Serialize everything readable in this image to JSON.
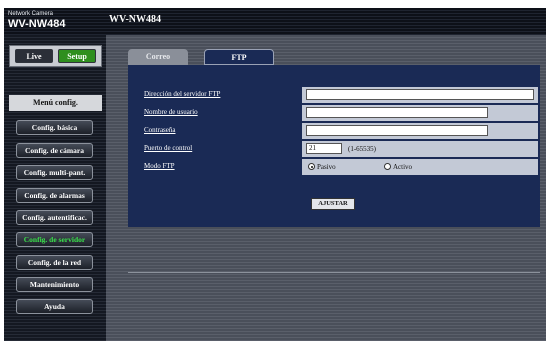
{
  "header": {
    "brand_small": "Network Camera",
    "brand_model": "WV-NW484",
    "model_title": "WV-NW484"
  },
  "mode": {
    "live_label": "Live",
    "setup_label": "Setup"
  },
  "sidebar": {
    "title": "Menú config.",
    "items": [
      {
        "label": "Config. básica"
      },
      {
        "label": "Config. de cámara"
      },
      {
        "label": "Config. multi-pant."
      },
      {
        "label": "Config. de alarmas"
      },
      {
        "label": "Config. autentificac."
      },
      {
        "label": "Config. de servidor",
        "active": true
      },
      {
        "label": "Config. de la red"
      },
      {
        "label": "Mantenimiento"
      },
      {
        "label": "Ayuda"
      }
    ]
  },
  "tabs": [
    {
      "label": "Correo"
    },
    {
      "label": "FTP",
      "active": true
    }
  ],
  "form": {
    "ftp_server_label": "Dirección del servidor FTP",
    "ftp_server_value": "",
    "username_label": "Nombre de usuario",
    "username_value": "",
    "password_label": "Contraseña",
    "password_value": "",
    "control_port_label": "Puerto de control",
    "control_port_value": "21",
    "control_port_hint": "(1-65535)",
    "ftp_mode_label": "Modo FTP",
    "ftp_mode_options": [
      "Pasivo",
      "Activo"
    ],
    "ftp_mode_selected": "Pasivo",
    "submit_label": "AJUSTAR"
  },
  "colors": {
    "panel_bg": "#1a2a55",
    "active_menu": "#39e04a",
    "setup_green": "#2f8f1e"
  }
}
